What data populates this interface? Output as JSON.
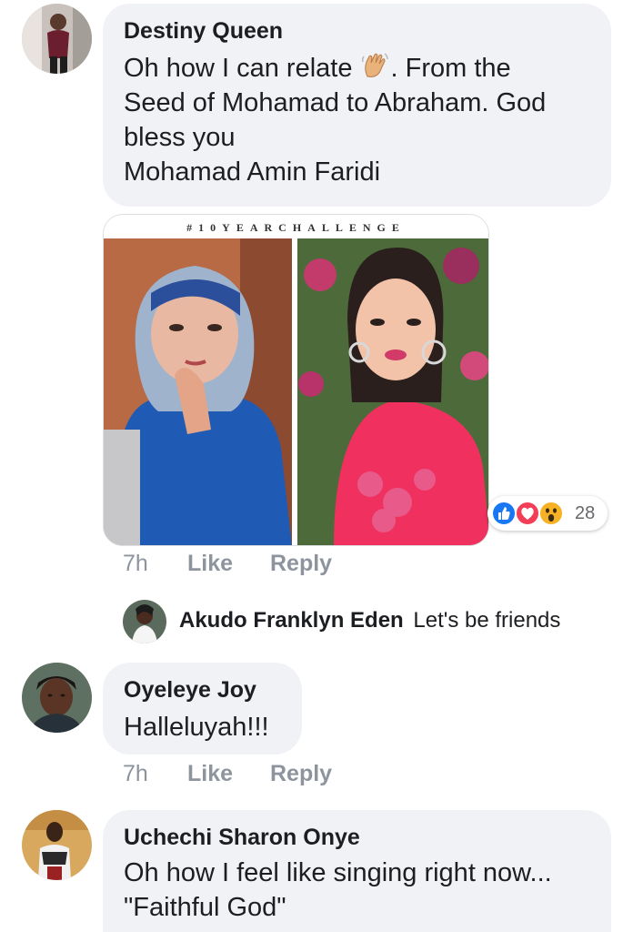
{
  "comments": [
    {
      "author": "Destiny Queen",
      "line1_before": "Oh how I can relate ",
      "line1_emoji": "waving-hand-icon",
      "line1_after": ". From the",
      "line2": "Seed of Mohamad to Abraham. God",
      "line3": "bless you",
      "line4": "Mohamad Amin Faridi",
      "attachment_caption": "#10YEARCHALLENGE",
      "reactions": [
        "like-icon",
        "love-icon",
        "wow-icon"
      ],
      "reaction_count": "28",
      "time": "7h",
      "like_label": "Like",
      "reply_label": "Reply"
    },
    {
      "author": "Akudo Franklyn Eden",
      "text": "Let's be friends"
    },
    {
      "author": "Oyeleye Joy",
      "text": "Halleluyah!!!",
      "time": "7h",
      "like_label": "Like",
      "reply_label": "Reply"
    },
    {
      "author": "Uchechi Sharon Onye",
      "line1": "Oh how I feel like singing right now...",
      "line2": "\"Faithful God\""
    }
  ],
  "colors": {
    "bubble": "#f0f2f5",
    "meta_text": "#8d949e",
    "like_blue": "#1877f2",
    "love_red": "#f33e58",
    "wow_yellow": "#f7b125"
  }
}
